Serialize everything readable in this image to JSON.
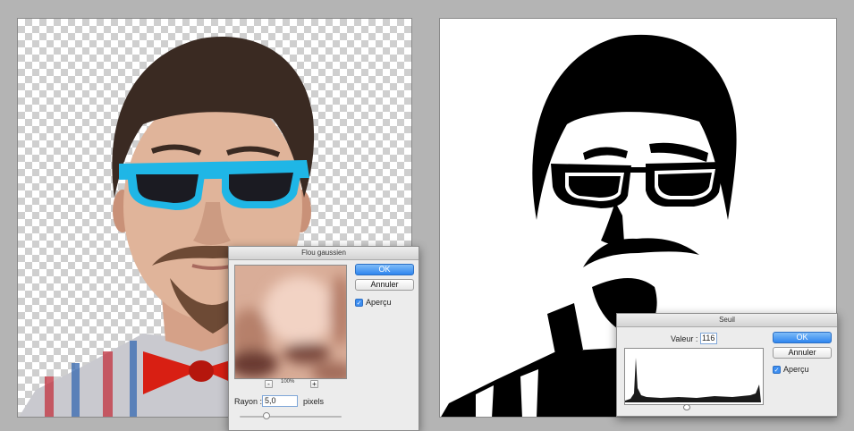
{
  "blur_dialog": {
    "title": "Flou gaussien",
    "ok_label": "OK",
    "cancel_label": "Annuler",
    "preview_label": "Aperçu",
    "preview_checked": true,
    "zoom_out_label": "-",
    "zoom_level": "100%",
    "zoom_in_label": "+",
    "radius_label": "Rayon :",
    "radius_value": "5,0",
    "radius_unit": "pixels"
  },
  "threshold_dialog": {
    "title": "Seuil",
    "value_label": "Valeur :",
    "value": "116",
    "ok_label": "OK",
    "cancel_label": "Annuler",
    "preview_label": "Aperçu",
    "preview_checked": true
  },
  "colors": {
    "glasses": "#1fb6e6",
    "bow_tie": "#d81f13",
    "accent": "#3d8ef0"
  }
}
